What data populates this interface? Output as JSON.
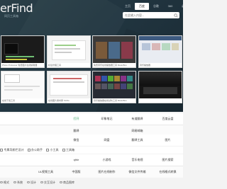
{
  "header": {
    "logo": "erFind",
    "subtitle": "网页工具箱",
    "nav": [
      "主页",
      "百度",
      "谷歌",
      "360",
      "必应",
      "搜狗"
    ],
    "search_placeholder": "在此输入内容..."
  },
  "thumbnails": [
    {
      "caption": "Photo Professor 免费图片在线编辑器"
    },
    {
      "caption": "标签管理工具"
    },
    {
      "caption": "免费音乐在线播放器工具 MusicBox"
    },
    {
      "caption": "音乐播放器"
    },
    {
      "caption": "在线下载工具"
    },
    {
      "caption": "在线图片素材库 Sizzle"
    },
    {
      "caption": "音乐播放器在线试听工具 MusicBox"
    },
    {
      "caption": ""
    }
  ],
  "grid_rows": [
    [
      "",
      "",
      "打开",
      "印象笔记",
      "有道翻译",
      "百度云盘"
    ],
    [
      "",
      "",
      "翻译",
      "",
      "网易邮箱",
      ""
    ],
    [
      "",
      "",
      "微信",
      "网盘",
      "翻译工具",
      "图片"
    ]
  ],
  "checks": [
    "专属导航栏设计",
    "办公助手",
    "小工具",
    "工具箱"
  ],
  "lower_rows": [
    [
      "",
      "",
      "qhkr",
      "小游戏",
      "音乐电视",
      "图片搜索"
    ],
    [
      "",
      "UL视频工具",
      "中国版",
      "图片在线制作",
      "微信文件传输",
      "在线格式转换"
    ]
  ],
  "tags": [
    "格式",
    "系统",
    "设计",
    "交互设计",
    "商品图库"
  ]
}
